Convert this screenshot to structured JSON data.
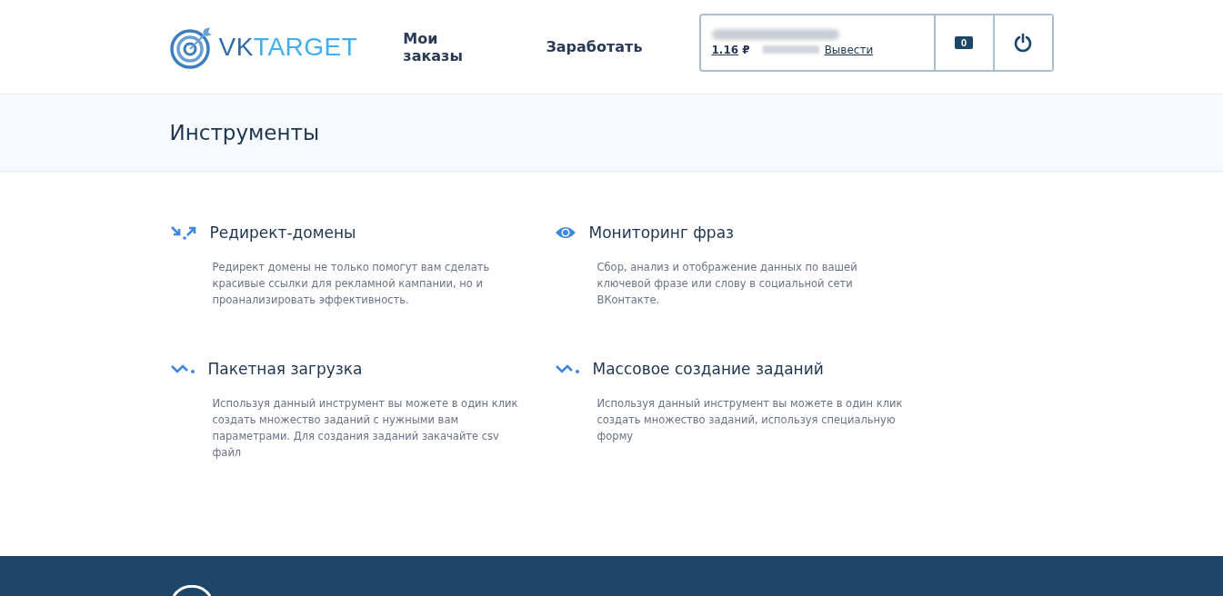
{
  "logo": {
    "prefix": "VK",
    "suffix": "TARGET"
  },
  "nav": [
    {
      "label": "Мои заказы"
    },
    {
      "label": "Заработать"
    }
  ],
  "account": {
    "balance": "1.16",
    "currency": "₽",
    "withdraw": "Вывести",
    "messages": "0"
  },
  "page_title": "Инструменты",
  "tools": [
    {
      "kind": "redirect",
      "title": "Редирект-домены",
      "description": "Редирект домены не только помогут вам сделать красивые ссылки для рекламной кампании, но и проанализировать эффективность."
    },
    {
      "kind": "eye",
      "title": "Мониторинг фраз",
      "description": "Сбор, анализ и отображение данных по вашей ключевой фразе или слову в социальной сети ВКонтакте."
    },
    {
      "kind": "wave",
      "title": "Пакетная загрузка",
      "description": "Используя данный инструмент вы можете в один клик создать множество заданий с нужными вам параметрами. Для создания заданий закачайте csv файл"
    },
    {
      "kind": "wave",
      "title": "Массовое создание заданий",
      "description": "Используя данный инструмент вы можете в один клик создать множество заданий, используя специальную форму"
    }
  ]
}
